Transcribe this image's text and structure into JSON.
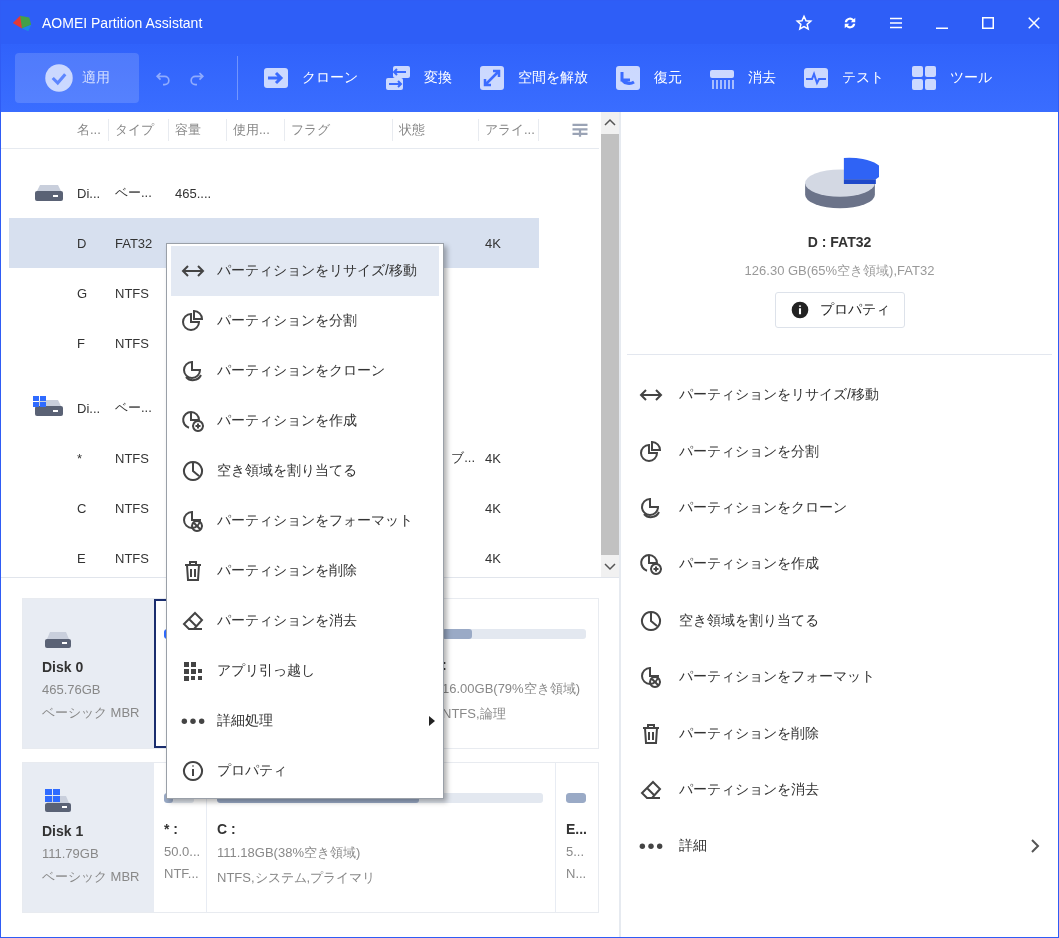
{
  "window": {
    "title": "AOMEI Partition Assistant"
  },
  "toolbar": {
    "apply": {
      "label": "適用",
      "disabled": true
    },
    "undo": {
      "disabled": true
    },
    "redo": {
      "disabled": true
    },
    "tools": [
      {
        "label": "クローン"
      },
      {
        "label": "変換"
      },
      {
        "label": "空間を解放"
      },
      {
        "label": "復元"
      },
      {
        "label": "消去"
      },
      {
        "label": "テスト"
      },
      {
        "label": "ツール"
      }
    ]
  },
  "table": {
    "columns": [
      "名...",
      "タイプ",
      "容量",
      "使用...",
      "フラグ",
      "状態",
      "アライ..."
    ],
    "rows": [
      {
        "kind": "disk",
        "selected": false,
        "name": "Di...",
        "type": "ベー...",
        "capacity": "465...."
      },
      {
        "kind": "partition",
        "selected": true,
        "name": "D",
        "type": "FAT32",
        "alignment": "4K"
      },
      {
        "kind": "partition",
        "selected": false,
        "name": "G",
        "type": "NTFS"
      },
      {
        "kind": "partition",
        "selected": false,
        "name": "F",
        "type": "NTFS"
      },
      {
        "kind": "system_disk",
        "selected": false,
        "name": "Di...",
        "type": "ベー..."
      },
      {
        "kind": "partition",
        "selected": false,
        "name": "*",
        "type": "NTFS",
        "status": "ブ...",
        "alignment": "4K"
      },
      {
        "kind": "partition",
        "selected": false,
        "name": "C",
        "type": "NTFS",
        "alignment": "4K"
      },
      {
        "kind": "partition",
        "selected": false,
        "name": "E",
        "type": "NTFS",
        "alignment": "4K"
      }
    ]
  },
  "disk_map": [
    {
      "name": "Disk 0",
      "size": "465.76GB",
      "style": "ベーシック MBR",
      "kind": "disk",
      "partitions": [
        {
          "selected": true,
          "level": 0.35
        },
        {
          "selected": false,
          "name": ":",
          "detail": "16.00GB(79%空き領域)",
          "info": "NTFS,論理",
          "level": 0.21
        }
      ]
    },
    {
      "name": "Disk 1",
      "size": "111.79GB",
      "style": "ベーシック MBR",
      "kind": "system_disk",
      "partitions": [
        {
          "selected": false,
          "name": "* :",
          "detail": "50.0...",
          "info": "NTF...",
          "level": 0.3
        },
        {
          "selected": false,
          "name": "C :",
          "detail": "111.18GB(38%空き領域)",
          "info": "NTFS,システム,プライマリ",
          "level": 0.62
        },
        {
          "selected": false,
          "name": "E...",
          "detail": "5...",
          "info": "N...",
          "level": 1
        }
      ]
    }
  ],
  "context_menu": {
    "items": [
      {
        "label": "パーティションをリサイズ/移動",
        "selected": true,
        "submenu": false
      },
      {
        "label": "パーティションを分割",
        "selected": false,
        "submenu": false
      },
      {
        "label": "パーティションをクローン",
        "selected": false,
        "submenu": false
      },
      {
        "label": "パーティションを作成",
        "selected": false,
        "submenu": false
      },
      {
        "label": "空き領域を割り当てる",
        "selected": false,
        "submenu": false
      },
      {
        "label": "パーティションをフォーマット",
        "selected": false,
        "submenu": false
      },
      {
        "label": "パーティションを削除",
        "selected": false,
        "submenu": false
      },
      {
        "label": "パーティションを消去",
        "selected": false,
        "submenu": false
      },
      {
        "label": "アプリ引っ越し",
        "selected": false,
        "submenu": false
      },
      {
        "label": "詳細処理",
        "selected": false,
        "submenu": true
      },
      {
        "label": "プロパティ",
        "selected": false,
        "submenu": false
      }
    ]
  },
  "details": {
    "title": "D : FAT32",
    "summary": "126.30 GB(65%空き領域),FAT32",
    "button": "プロパティ",
    "actions": [
      {
        "label": "パーティションをリサイズ/移動",
        "submenu": false
      },
      {
        "label": "パーティションを分割",
        "submenu": false
      },
      {
        "label": "パーティションをクローン",
        "submenu": false
      },
      {
        "label": "パーティションを作成",
        "submenu": false
      },
      {
        "label": "空き領域を割り当てる",
        "submenu": false
      },
      {
        "label": "パーティションをフォーマット",
        "submenu": false
      },
      {
        "label": "パーティションを削除",
        "submenu": false
      },
      {
        "label": "パーティションを消去",
        "submenu": false
      },
      {
        "label": "詳細",
        "submenu": true
      }
    ]
  }
}
